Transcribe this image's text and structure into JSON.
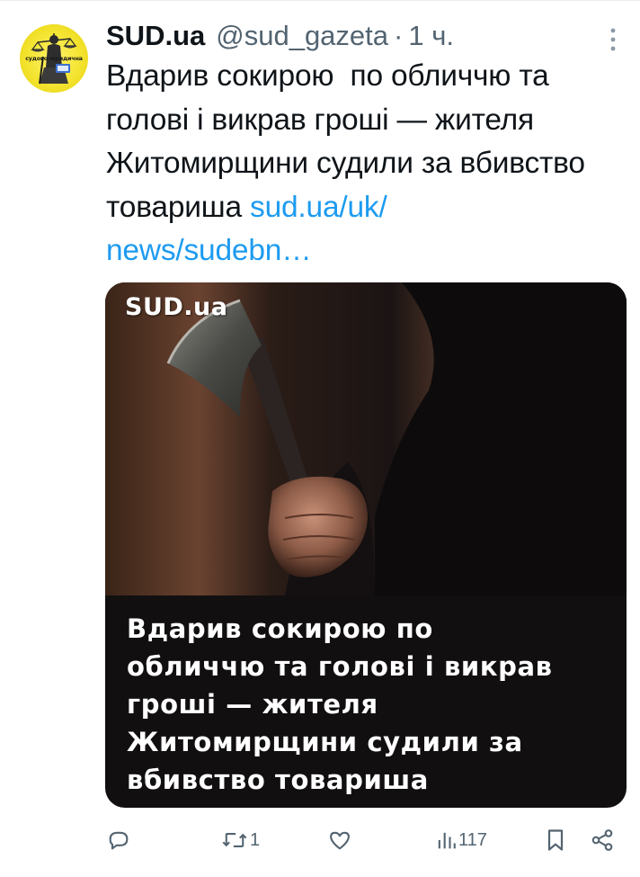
{
  "tweet": {
    "display_name": "SUD.ua",
    "handle": "@sud_gazeta",
    "separator": "·",
    "time": "1 ч.",
    "text": "Вдарив сокирою  по обличчю та голові і викрав гроші — жителя Житомирщини судили за вбивство товариша ",
    "link_text": "sud.ua/uk/\nnews/sudebn…",
    "avatar": {
      "banner_text": "судово-юридична",
      "icon": "themis-justice-logo"
    },
    "more_icon": "more-vertical-icon"
  },
  "media": {
    "logo_text": "SUD.ua",
    "headline": "Вдарив сокирою по\nобличчю та голові і викрав\nгроші — жителя\nЖитомирщини судили за\nвбивство товариша",
    "photo_description_icon": "axe-in-hand-photo"
  },
  "actions": {
    "reply": {
      "icon": "reply-icon",
      "count": ""
    },
    "retweet": {
      "icon": "retweet-icon",
      "count": "1"
    },
    "like": {
      "icon": "heart-icon",
      "count": ""
    },
    "views": {
      "icon": "views-chart-icon",
      "count": "117"
    },
    "bookmark": {
      "icon": "bookmark-icon"
    },
    "share": {
      "icon": "share-icon"
    }
  },
  "colors": {
    "text": "#0f1419",
    "secondary": "#536471",
    "link": "#1d9bf0",
    "avatar_bg": "#f3e22c"
  }
}
